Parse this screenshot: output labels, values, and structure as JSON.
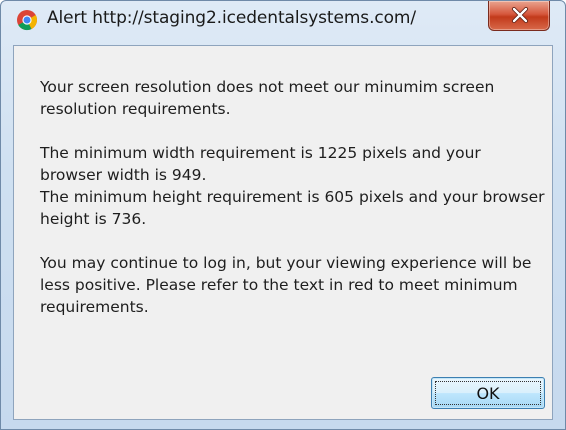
{
  "window": {
    "title": "Alert http://staging2.icedentalsystems.com/",
    "icon": "chrome-browser-icon",
    "close_icon": "close-icon"
  },
  "message": {
    "paragraph_1": "Your screen resolution does not meet our minumim screen resolution requirements.",
    "paragraph_2_line_1": "The minimum width requirement is 1225 pixels and your browser width is 949.",
    "paragraph_2_line_2": "The minimum height requirement is 605 pixels and your browser height is 736.",
    "paragraph_3": "You may continue to log in, but your viewing experience will be less positive.  Please refer to the text in red to meet minimum requirements."
  },
  "buttons": {
    "ok_label": "OK"
  },
  "colors": {
    "frame": "#cfe0f1",
    "close_button": "#c23a1b",
    "ok_button": "#bee6fd",
    "client_background": "#f0f0f0"
  }
}
